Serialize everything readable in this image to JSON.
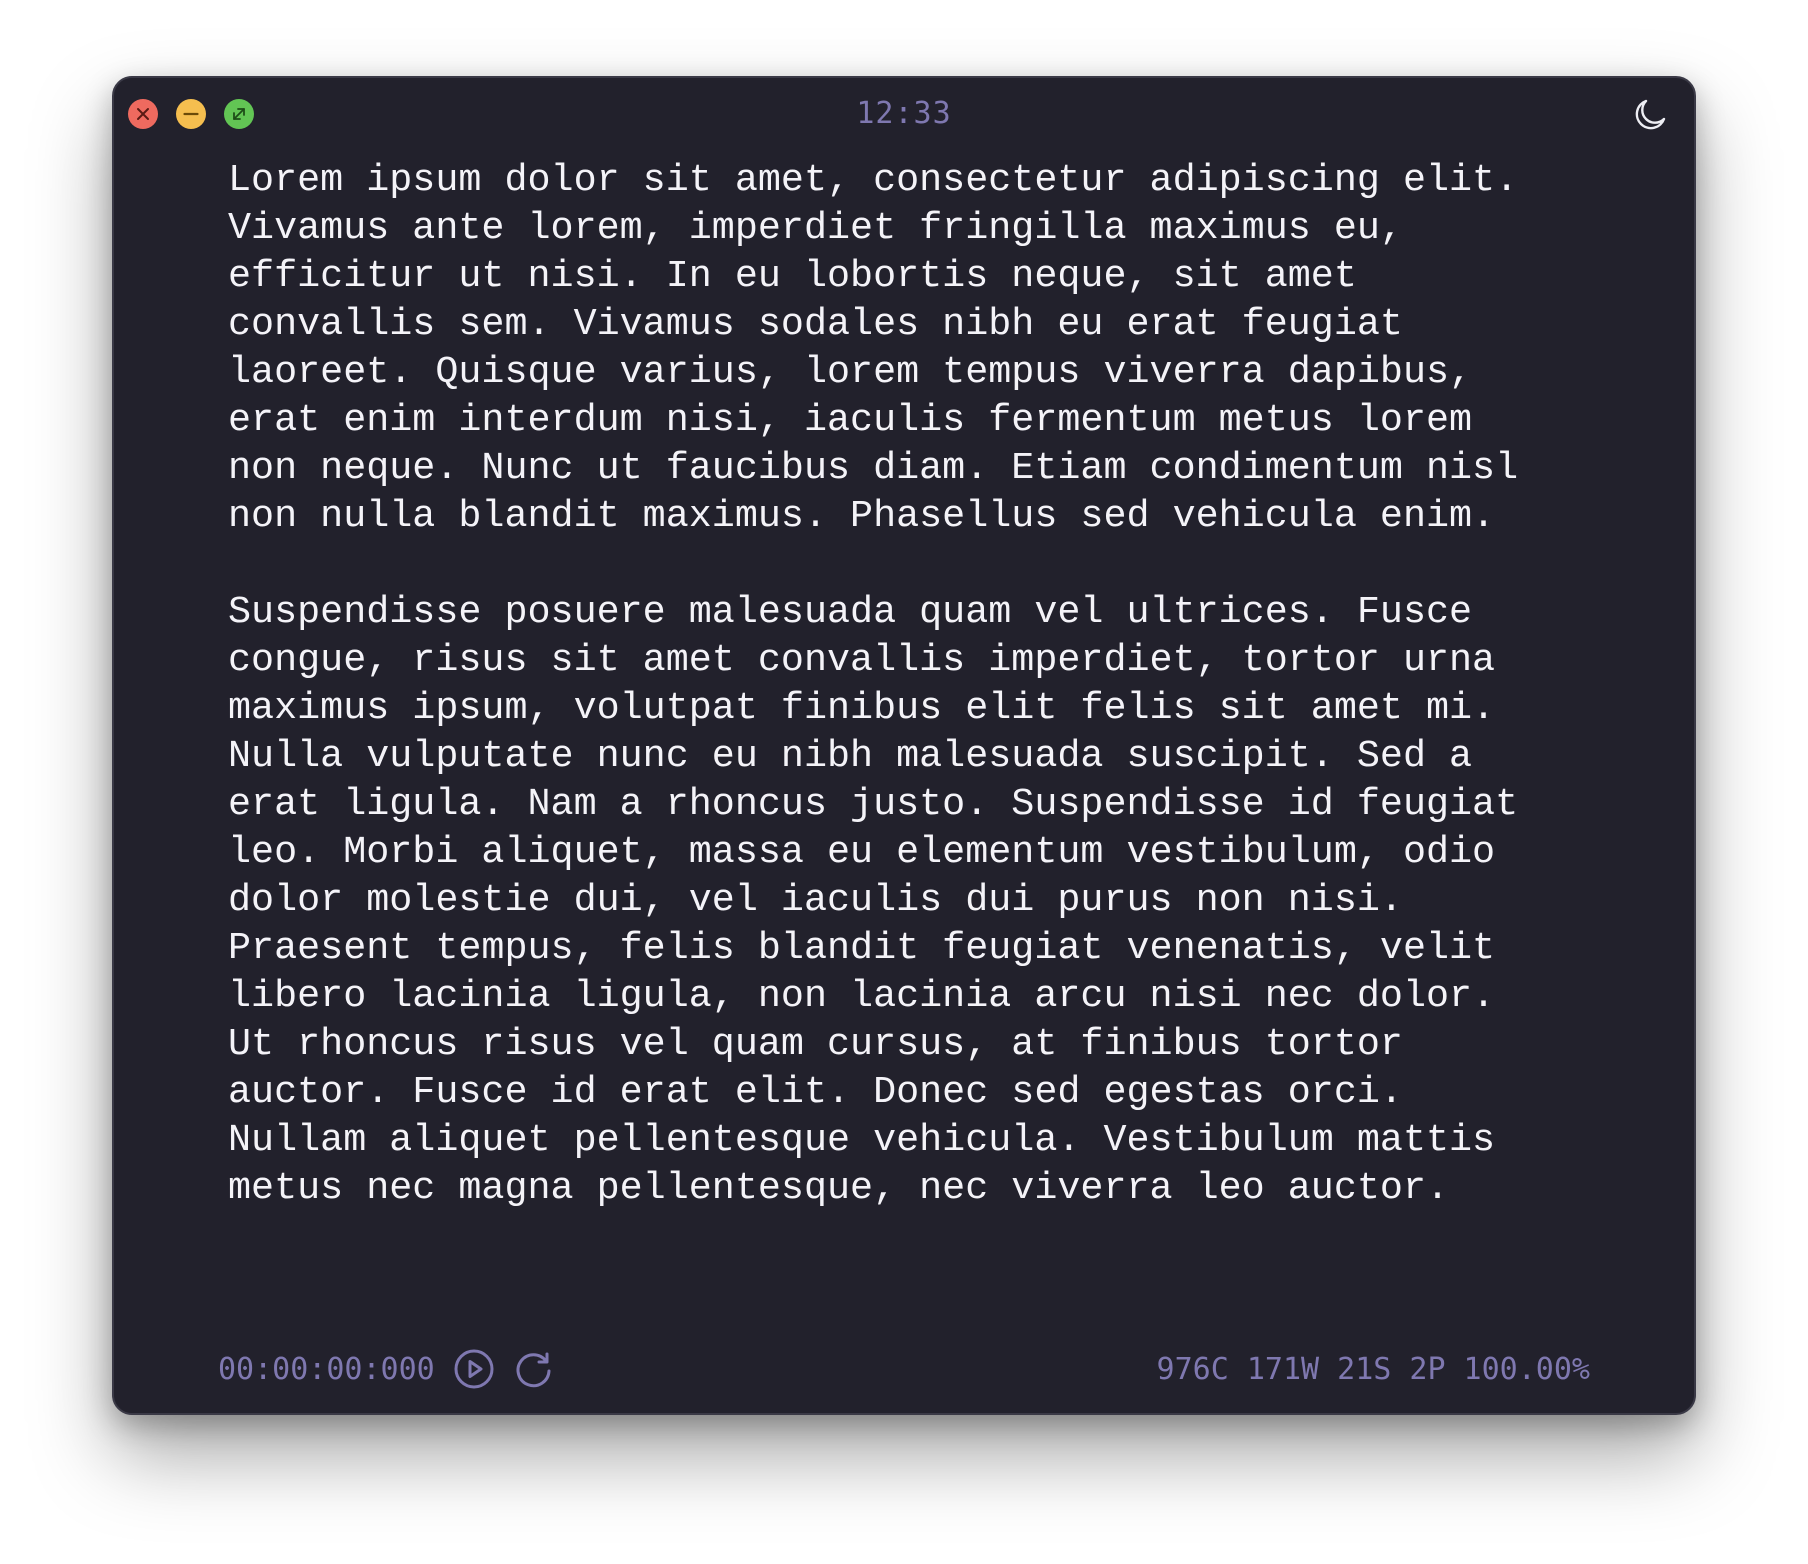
{
  "window": {
    "title": "12:33"
  },
  "icons": {
    "close": "close-icon",
    "minimize": "minimize-icon",
    "fullscreen": "fullscreen-icon",
    "theme": "moon-icon",
    "play": "play-icon",
    "reset": "reset-icon"
  },
  "colors": {
    "background": "#22212c",
    "text": "#f4f3f8",
    "muted": "#7f78b0",
    "close": "#ee6a5f",
    "minimize": "#f5be4f",
    "fullscreen": "#62c554"
  },
  "document": {
    "paragraphs": [
      "Lorem ipsum dolor sit amet, consectetur adipiscing elit.\nVivamus ante lorem, imperdiet fringilla maximus eu,\nefficitur ut nisi. In eu lobortis neque, sit amet\nconvallis sem. Vivamus sodales nibh eu erat feugiat\nlaoreet. Quisque varius, lorem tempus viverra dapibus,\nerat enim interdum nisi, iaculis fermentum metus lorem\nnon neque. Nunc ut faucibus diam. Etiam condimentum nisl\nnon nulla blandit maximus. Phasellus sed vehicula enim.",
      "Suspendisse posuere malesuada quam vel ultrices. Fusce\ncongue, risus sit amet convallis imperdiet, tortor urna\nmaximus ipsum, volutpat finibus elit felis sit amet mi.\nNulla vulputate nunc eu nibh malesuada suscipit. Sed a\nerat ligula. Nam a rhoncus justo. Suspendisse id feugiat\nleo. Morbi aliquet, massa eu elementum vestibulum, odio\ndolor molestie dui, vel iaculis dui purus non nisi.\nPraesent tempus, felis blandit feugiat venenatis, velit\nlibero lacinia ligula, non lacinia arcu nisi nec dolor.\nUt rhoncus risus vel quam cursus, at finibus tortor\nauctor. Fusce id erat elit. Donec sed egestas orci.\nNullam aliquet pellentesque vehicula. Vestibulum mattis\nmetus nec magna pellentesque, nec viverra leo auctor."
    ]
  },
  "footer": {
    "timer": "00:00:00:000",
    "stats": "976C 171W 21S 2P 100.00%"
  }
}
